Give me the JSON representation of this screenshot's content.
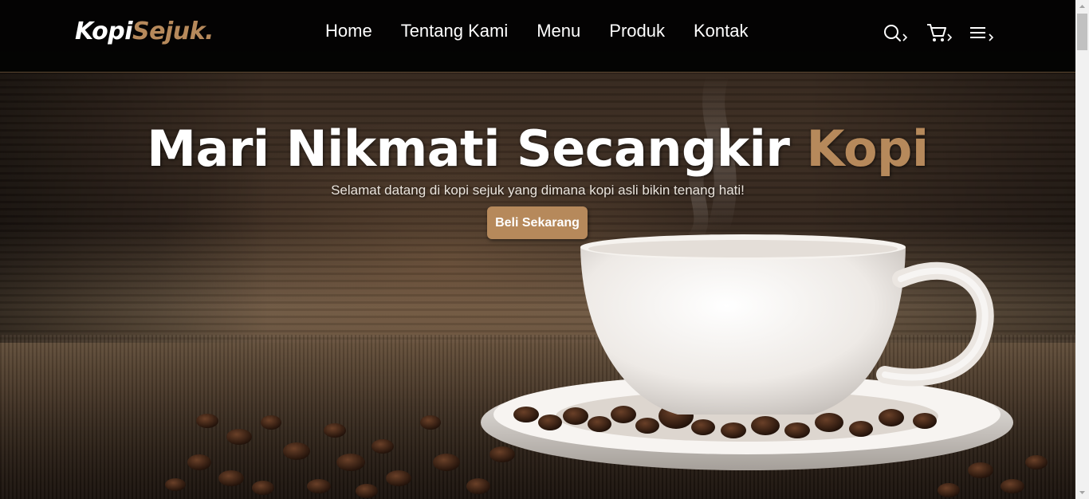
{
  "navbar": {
    "logo": {
      "part1": "Kopi",
      "part2": "Sejuk",
      "dot": "."
    },
    "links": [
      {
        "label": "Home"
      },
      {
        "label": "Tentang Kami"
      },
      {
        "label": "Menu"
      },
      {
        "label": "Produk"
      },
      {
        "label": "Kontak"
      }
    ],
    "icons": [
      "search-icon",
      "shopping-cart-icon",
      "menu-icon"
    ]
  },
  "hero": {
    "title_main": "Mari Nikmati Secangkir ",
    "title_accent": "Kopi",
    "subtitle": "Selamat datang di kopi sejuk yang dimana kopi asli bikin tenang hati!",
    "cta_label": "Beli Sekarang"
  },
  "colors": {
    "accent": "#b6895b",
    "navbar_bg": "#020202",
    "text": "#ffffff"
  }
}
